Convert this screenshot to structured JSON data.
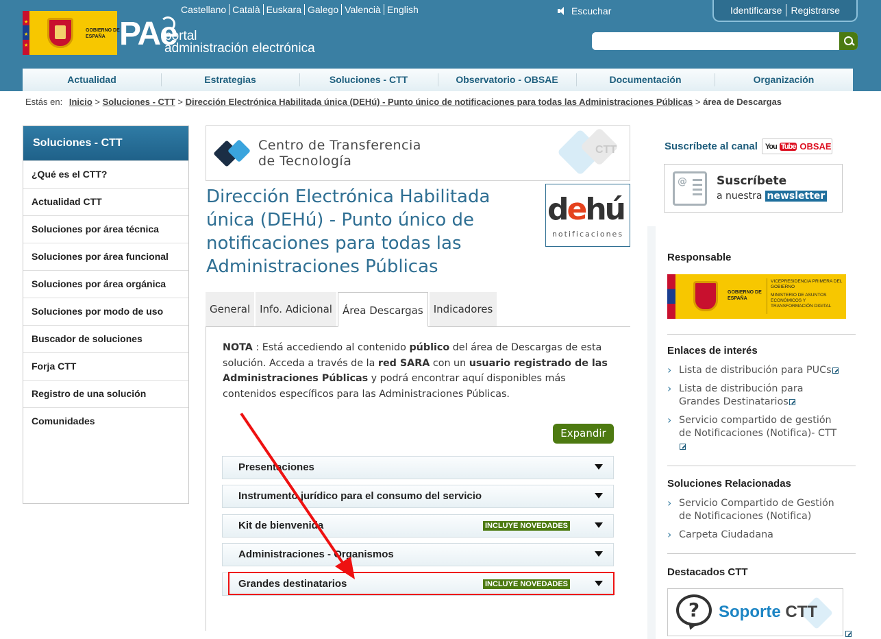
{
  "header": {
    "languages": [
      "Castellano",
      "Català",
      "Euskara",
      "Galego",
      "Valencià",
      "English"
    ],
    "listen_label": "Escuchar",
    "login_label": "Identificarse",
    "register_label": "Registrarse",
    "search_placeholder": "",
    "gov_logo_text": "GOBIERNO DE ESPAÑA",
    "pae_mark": "PAe",
    "pae_line1": "portal",
    "pae_line2": "administración electrónica"
  },
  "nav": [
    "Actualidad",
    "Estrategias",
    "Soluciones - CTT",
    "Observatorio - OBSAE",
    "Documentación",
    "Organización"
  ],
  "breadcrumb": {
    "label": "Estás en:",
    "links": [
      "Inicio",
      "Soluciones - CTT",
      "Dirección Electrónica Habilitada única (DEHú) - Punto único de notificaciones para todas las Administraciones Públicas"
    ],
    "current": "área de Descargas"
  },
  "sidebar": {
    "title": "Soluciones - CTT",
    "items": [
      "¿Qué es el CTT?",
      "Actualidad CTT",
      "Soluciones por área técnica",
      "Soluciones por área funcional",
      "Soluciones por área orgánica",
      "Soluciones por modo de uso",
      "Buscador de soluciones",
      "Forja CTT",
      "Registro de una solución",
      "Comunidades"
    ]
  },
  "banner": {
    "line1": "Centro de  Transferencia",
    "line2": "de Tecnología",
    "watermark": "CTT"
  },
  "page_title": "Dirección Electrónica Habilitada única (DEHú) - Punto único de notificaciones para todas las Administraciones Públicas",
  "dehu": {
    "d": "d",
    "e": "e",
    "rest": "hú",
    "sub": "notificaciones"
  },
  "tabs": [
    "General",
    "Info. Adicional",
    "Área Descargas",
    "Indicadores"
  ],
  "nota": {
    "p1": "NOTA",
    "p2": " : Está accediendo al contenido ",
    "p3": "público",
    "p4": " del área de Descargas de esta solución. Acceda a través de la ",
    "p5": "red SARA",
    "p6": " con un ",
    "p7": "usuario registrado de las Administraciones Públicas",
    "p8": " y podrá encontrar aquí disponibles más contenidos específicos para las Administraciones Públicas."
  },
  "expand_label": "Expandir",
  "accordion": [
    {
      "label": "Presentaciones",
      "badge": ""
    },
    {
      "label": "Instrumento jurídico para el consumo del servicio",
      "badge": ""
    },
    {
      "label": "Kit de bienvenida",
      "badge": "INCLUYE NOVEDADES"
    },
    {
      "label": "Administraciones - Organismos",
      "badge": ""
    },
    {
      "label": "Grandes destinatarios",
      "badge": "INCLUYE NOVEDADES"
    }
  ],
  "right": {
    "subscribe_channel": "Suscríbete al canal",
    "yt_you": "You",
    "yt_tube": "Tube",
    "yt_obsae": "OBSAE",
    "newsletter_t1": "Suscríbete",
    "newsletter_t2": "a nuestra",
    "newsletter_t3": "newsletter",
    "responsable_title": "Responsable",
    "gov_line": "GOBIERNO DE ESPAÑA",
    "ministry_line1": "VICEPRESIDENCIA PRIMERA DEL GOBIERNO",
    "ministry_line2": "MINISTERIO DE ASUNTOS ECONÓMICOS Y TRANSFORMACIÓN DIGITAL",
    "enlaces_title": "Enlaces de interés",
    "enlaces": [
      "Lista de distribución para PUCs",
      "Lista de distribución para Grandes Destinatarios",
      "Servicio compartido de gestión de Notificaciones (Notifica)- CTT"
    ],
    "relacionadas_title": "Soluciones Relacionadas",
    "relacionadas": [
      "Servicio Compartido de Gestión de Notificaciones (Notifica)",
      "Carpeta Ciudadana"
    ],
    "destacados_title": "Destacados CTT",
    "soporte_a": "Soporte",
    "soporte_b": "CTT"
  },
  "colors": {
    "header_blue": "#3a7fa3",
    "title_blue": "#2f6f93",
    "accent_green": "#4d7a11",
    "annotation_red": "#ee1111"
  }
}
